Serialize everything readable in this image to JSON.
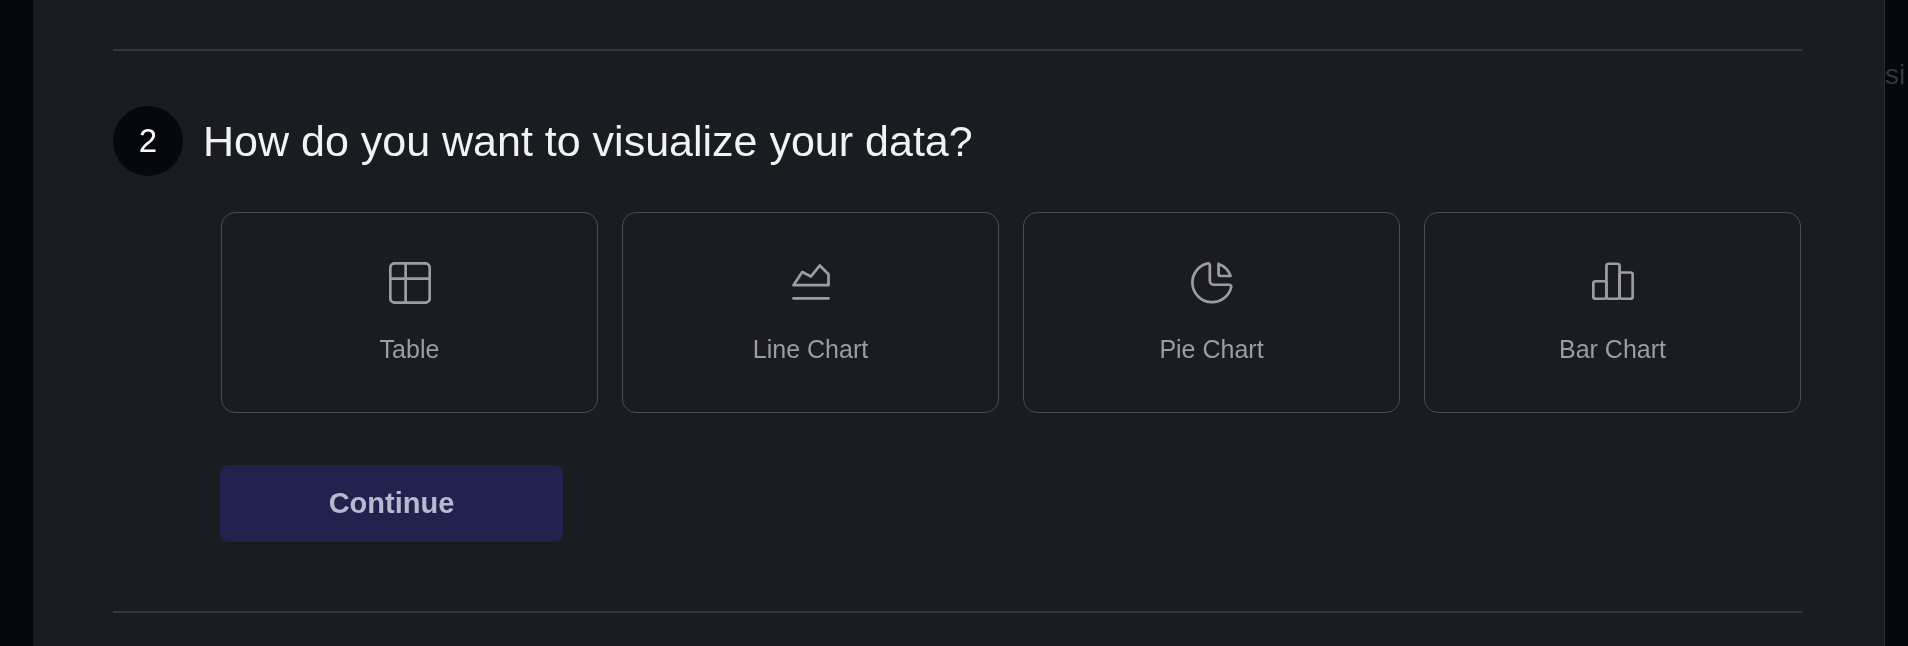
{
  "step": {
    "number": "2",
    "title": "How do you want to visualize your data?"
  },
  "options": [
    {
      "kind": "table",
      "label": "Table",
      "selected": false
    },
    {
      "kind": "line",
      "label": "Line Chart",
      "selected": false
    },
    {
      "kind": "pie",
      "label": "Pie Chart",
      "selected": false
    },
    {
      "kind": "bar",
      "label": "Bar Chart",
      "selected": false
    }
  ],
  "continue_button": {
    "label": "Continue",
    "disabled": true
  },
  "background_text": "si"
}
